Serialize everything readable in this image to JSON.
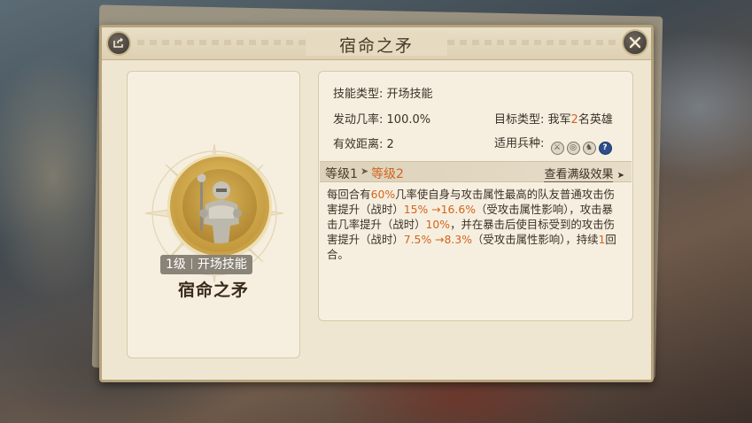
{
  "dialog": {
    "title": "宿命之矛",
    "share_icon": "share-icon",
    "close_icon": "close-icon"
  },
  "hero": {
    "level": "1级",
    "skill_type_badge": "开场技能",
    "skill_name": "宿命之矛",
    "portrait_icon": "armored-knight-portrait"
  },
  "info": {
    "skill_type_label": "技能类型:",
    "skill_type_value": "开场技能",
    "trigger_rate_label": "发动几率:",
    "trigger_rate_value": "100.0%",
    "target_type_label": "目标类型:",
    "target_type_prefix": "我军",
    "target_type_count": "2",
    "target_type_suffix": "名英雄",
    "range_label": "有效距离:",
    "range_value": "2",
    "troops_label": "适用兵种:",
    "troops_icons": [
      "sword-icon",
      "bow-icon",
      "horse-icon",
      "help-icon"
    ]
  },
  "levels": {
    "level1": "等级1",
    "level2": "等级2",
    "view_full": "查看满级效果"
  },
  "description": {
    "p1": "每回合有",
    "rate": "60%",
    "p2": "几率使自身与攻击属性最高的队友普通攻击伤害提升（战时）",
    "dmg_from": "15%",
    "arrow1": " →",
    "dmg_to": "16.6%",
    "p3": "（受攻击属性影响），攻击暴击几率提升（战时）",
    "crit": "10%",
    "p4": "，并在暴击后使目标受到的攻击伤害提升（战时）",
    "taken_from": "7.5%",
    "arrow2": " →",
    "taken_to": "8.3%",
    "p5": "（受攻击属性影响），持续",
    "turns": "1",
    "p6": "回合。"
  },
  "colors": {
    "highlight": "#d2641c",
    "panel": "#efe6d2",
    "border": "#b7a37b"
  }
}
